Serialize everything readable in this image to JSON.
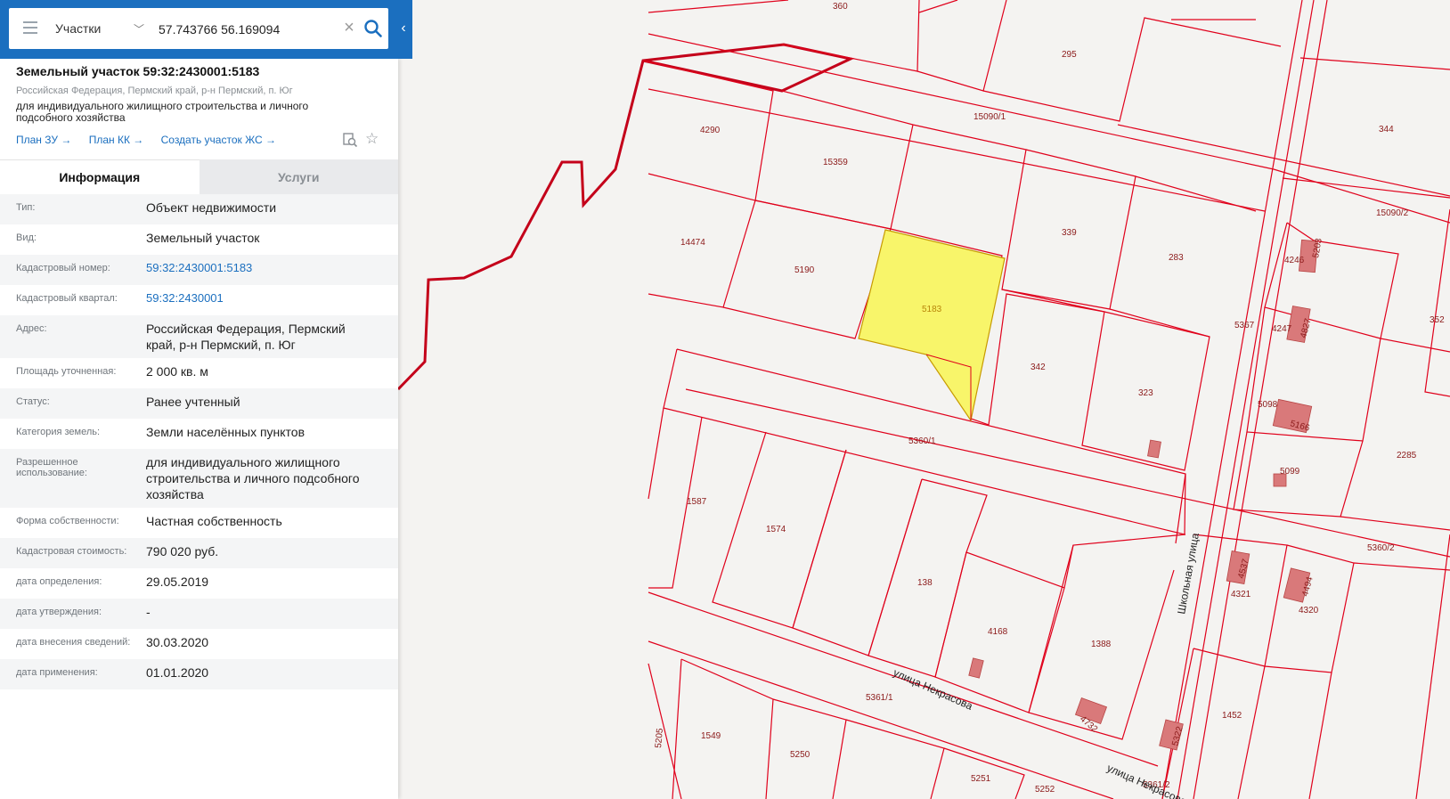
{
  "search": {
    "mode": "Участки",
    "query": "57.743766 56.169094"
  },
  "object": {
    "title": "Земельный участок 59:32:2430001:5183",
    "address": "Российская Федерация, Пермский край, р-н Пермский, п. Юг",
    "purpose": "для индивидуального жилищного строительства и личного подсобного хозяйства",
    "links": [
      "План ЗУ →",
      "План КК →",
      "Создать участок ЖС →"
    ]
  },
  "tabs": [
    "Информация",
    "Услуги"
  ],
  "info_rows": [
    {
      "key": "Тип:",
      "value": "Объект недвижимости"
    },
    {
      "key": "Вид:",
      "value": "Земельный участок"
    },
    {
      "key": "Кадастровый номер:",
      "value": "59:32:2430001:5183"
    },
    {
      "key": "Кадастровый квартал:",
      "value": "59:32:2430001"
    },
    {
      "key": "Адрес:",
      "value": "Российская Федерация, Пермский край, р-н Пермский, п. Юг"
    },
    {
      "key": "Площадь уточненная:",
      "value": "2 000 кв. м"
    },
    {
      "key": "Статус:",
      "value": "Ранее учтенный"
    },
    {
      "key": "Категория земель:",
      "value": "Земли населённых пунктов"
    },
    {
      "key": "Разрешенное использование:",
      "value": "для индивидуального жилищного строительства и личного подсобного хозяйства"
    },
    {
      "key": "Форма собственности:",
      "value": "Частная собственность"
    },
    {
      "key": "Кадастровая стоимость:",
      "value": "790 020 руб."
    },
    {
      "key": "дата определения:",
      "value": "29.05.2019"
    },
    {
      "key": "дата утверждения:",
      "value": "-"
    },
    {
      "key": "дата внесения сведений:",
      "value": "30.03.2020"
    },
    {
      "key": "дата применения:",
      "value": "01.01.2020"
    }
  ],
  "map": {
    "parcel_labels": {
      "p360": "360",
      "p295": "295",
      "p344": "344",
      "p15090_1": "15090/1",
      "p4290": "4290",
      "p15359": "15359",
      "p14474": "14474",
      "p5190": "5190",
      "p5183": "5183",
      "p339": "339",
      "p283": "283",
      "p15090_2": "15090/2",
      "p4246": "4246",
      "p5203": "5203",
      "p5367": "5367",
      "p4247": "4247",
      "p4827": "4827",
      "p352": "352",
      "p342": "342",
      "p323": "323",
      "p5098": "5098",
      "p5166": "5166",
      "p2285": "2285",
      "p5360_1": "5360/1",
      "p5099": "5099",
      "p1587": "1587",
      "p1574": "1574",
      "p138": "138",
      "p4168": "4168",
      "p1388": "1388",
      "p4537": "4537",
      "p4321": "4321",
      "p4494": "4494",
      "p4320": "4320",
      "p5360_2": "5360/2",
      "p5205": "5205",
      "p5361_1": "5361/1",
      "p1549": "1549",
      "p5250": "5250",
      "p4732": "4732",
      "p1452": "1452",
      "p5322": "5322",
      "p5251": "5251",
      "p5252": "5252",
      "p5361_2": "5361/2"
    },
    "streets": {
      "shkolnaya": "Школьная улица",
      "nekrasova1": "улица Некрасова",
      "nekrasova2": "улица Некрасова"
    },
    "colors": {
      "boundary": "#e0001b",
      "selected_fill": "#f8f56a",
      "building": "#d9797a",
      "admin_line": "#c4001a"
    }
  }
}
